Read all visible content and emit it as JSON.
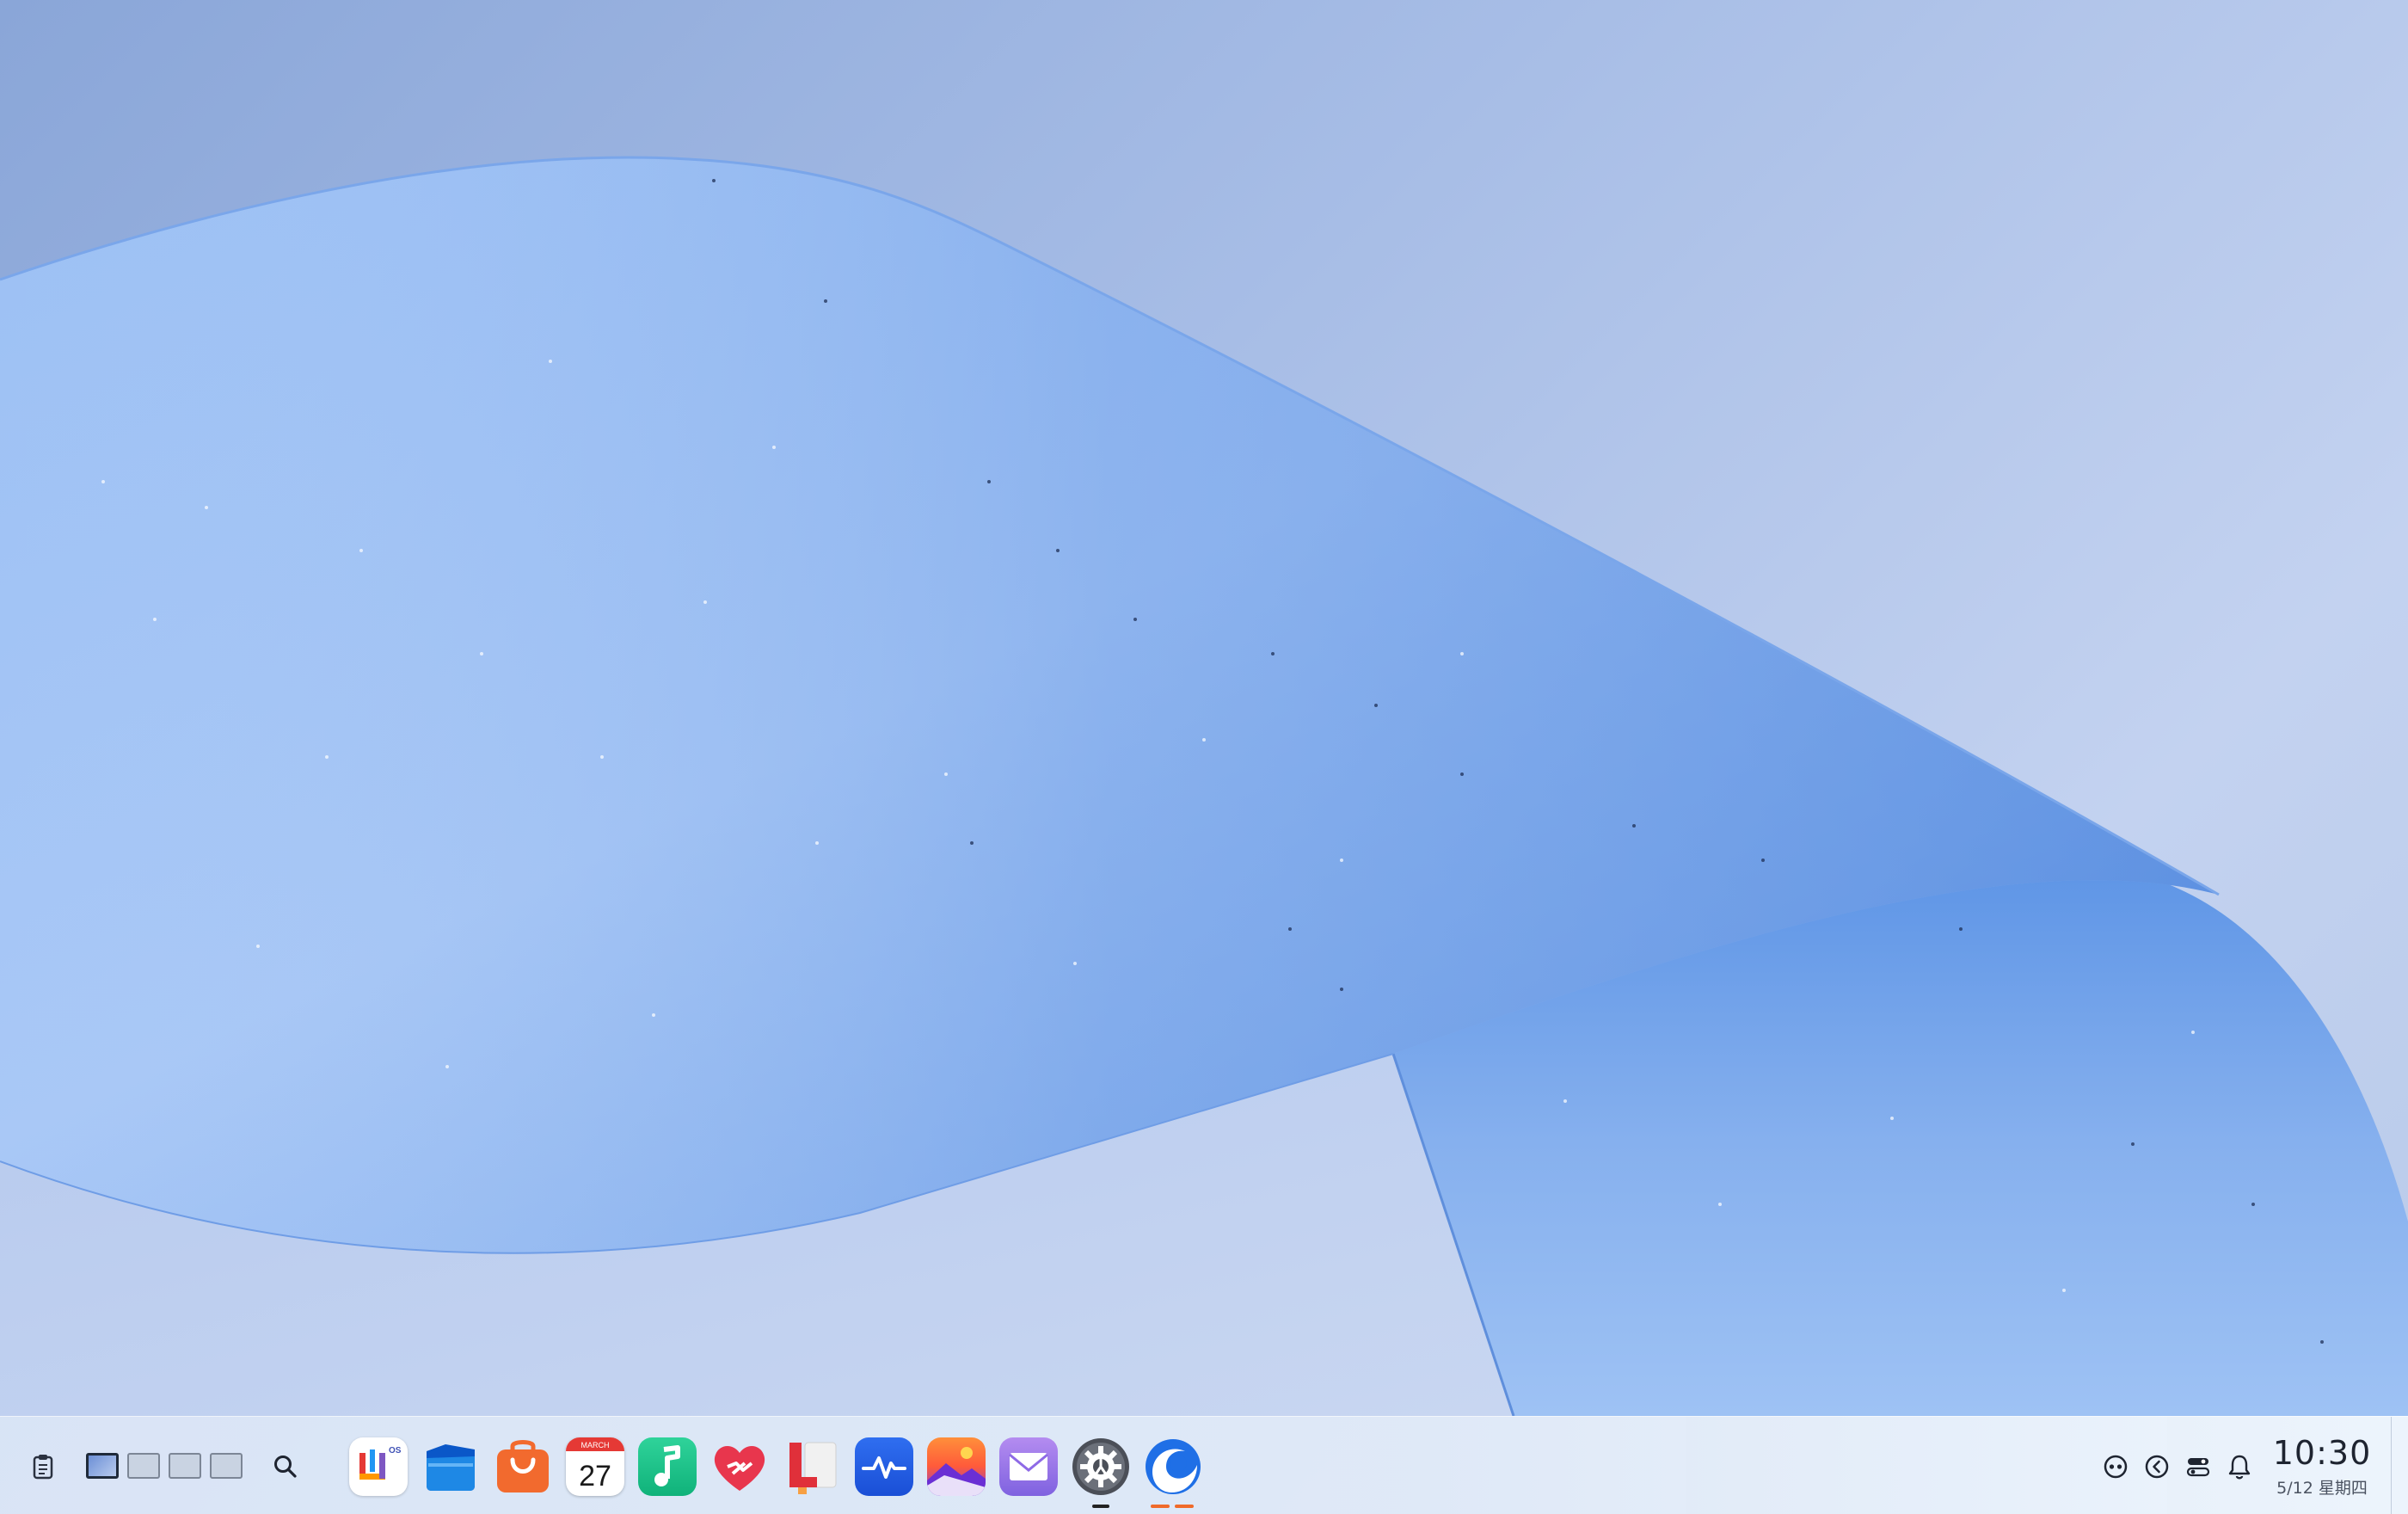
{
  "taskbar": {
    "workspaces": [
      "Desktop 1",
      "Desktop 2",
      "Desktop 3",
      "Desktop 4"
    ],
    "apps": [
      {
        "name": "uos-app-store-icon"
      },
      {
        "name": "file-manager-icon"
      },
      {
        "name": "shopping-bag-icon"
      },
      {
        "name": "calendar-icon",
        "month": "MARCH",
        "day": "27"
      },
      {
        "name": "music-icon"
      },
      {
        "name": "health-heart-icon"
      },
      {
        "name": "reader-icon"
      },
      {
        "name": "system-monitor-icon"
      },
      {
        "name": "photos-icon"
      },
      {
        "name": "mail-icon"
      },
      {
        "name": "settings-icon"
      },
      {
        "name": "browser-icon"
      }
    ],
    "clock": {
      "time": "10:30",
      "date": "5/12 星期四"
    }
  },
  "colors": {
    "taskbar_bg": "#dbe6f6",
    "wallpaper_ribbon": "#6f9ee6",
    "indicator_dark": "#222222",
    "indicator_orange": "#f06a2a"
  }
}
